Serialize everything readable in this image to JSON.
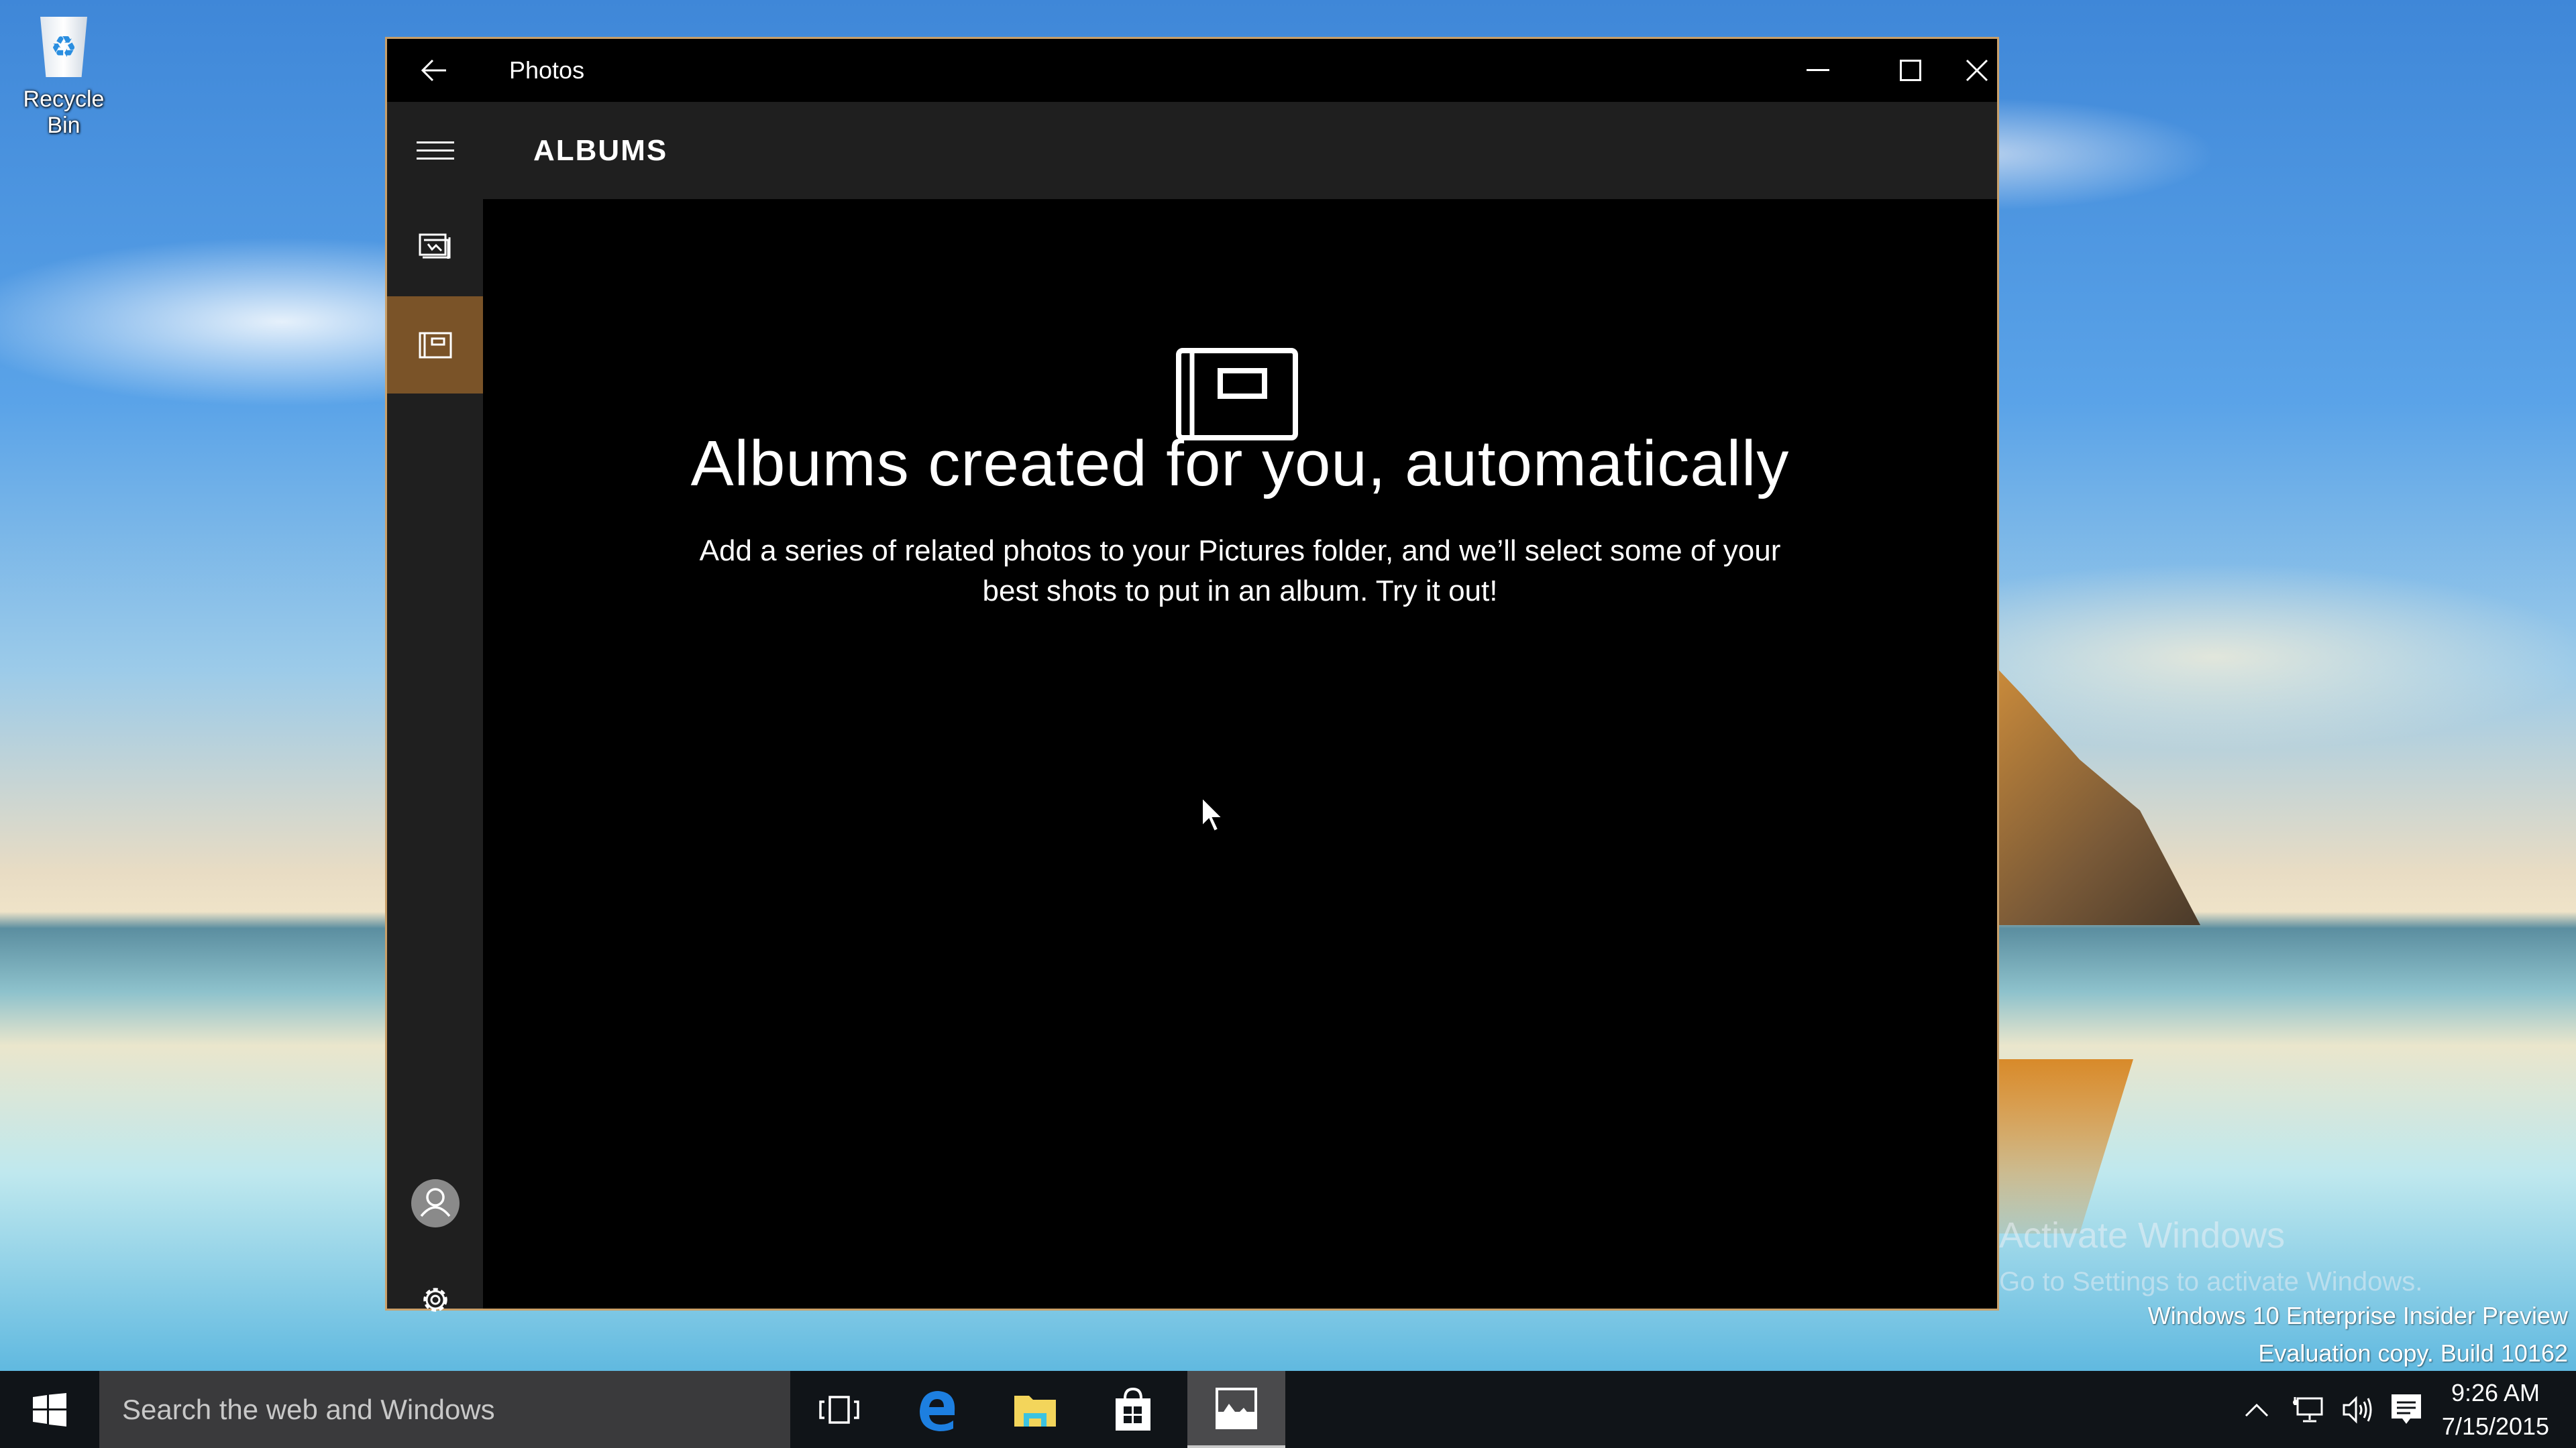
{
  "desktop": {
    "icons": [
      {
        "label": "Recycle Bin",
        "icon": "recycle-bin-icon"
      }
    ],
    "watermark": {
      "activate_title": "Activate Windows",
      "activate_hint": "Go to Settings to activate Windows.",
      "edition": "Windows 10 Enterprise Insider Preview",
      "build": "Evaluation copy. Build 10162"
    }
  },
  "window": {
    "title": "Photos",
    "back_icon": "back-arrow-icon",
    "caption_buttons": [
      "minimize",
      "maximize",
      "close"
    ],
    "accent_color": "#7a5328",
    "sidebar": {
      "items": [
        {
          "name": "menu",
          "icon": "hamburger-icon",
          "selected": false
        },
        {
          "name": "collection",
          "icon": "photos-collection-icon",
          "selected": false
        },
        {
          "name": "albums",
          "icon": "album-icon",
          "selected": true
        }
      ],
      "bottom_items": [
        {
          "name": "account",
          "icon": "user-icon"
        },
        {
          "name": "settings",
          "icon": "gear-icon"
        }
      ]
    },
    "header": {
      "title": "ALBUMS"
    },
    "empty_state": {
      "icon": "album-icon",
      "title": "Albums created for you, automatically",
      "body": "Add a series of related photos to your Pictures folder, and we’ll select some of your best shots to put in an album. Try it out!"
    }
  },
  "taskbar": {
    "search_placeholder": "Search the web and Windows",
    "pinned": [
      {
        "name": "task-view",
        "icon": "task-view-icon",
        "active": false
      },
      {
        "name": "edge",
        "icon": "edge-icon",
        "active": false
      },
      {
        "name": "file-explorer",
        "icon": "folder-icon",
        "active": false
      },
      {
        "name": "store",
        "icon": "store-icon",
        "active": false
      },
      {
        "name": "photos",
        "icon": "photos-icon",
        "active": true
      }
    ],
    "tray": {
      "icons": [
        "chevron-up-icon",
        "network-icon",
        "volume-icon",
        "action-center-icon"
      ],
      "time": "9:26 AM",
      "date": "7/15/2015"
    }
  }
}
